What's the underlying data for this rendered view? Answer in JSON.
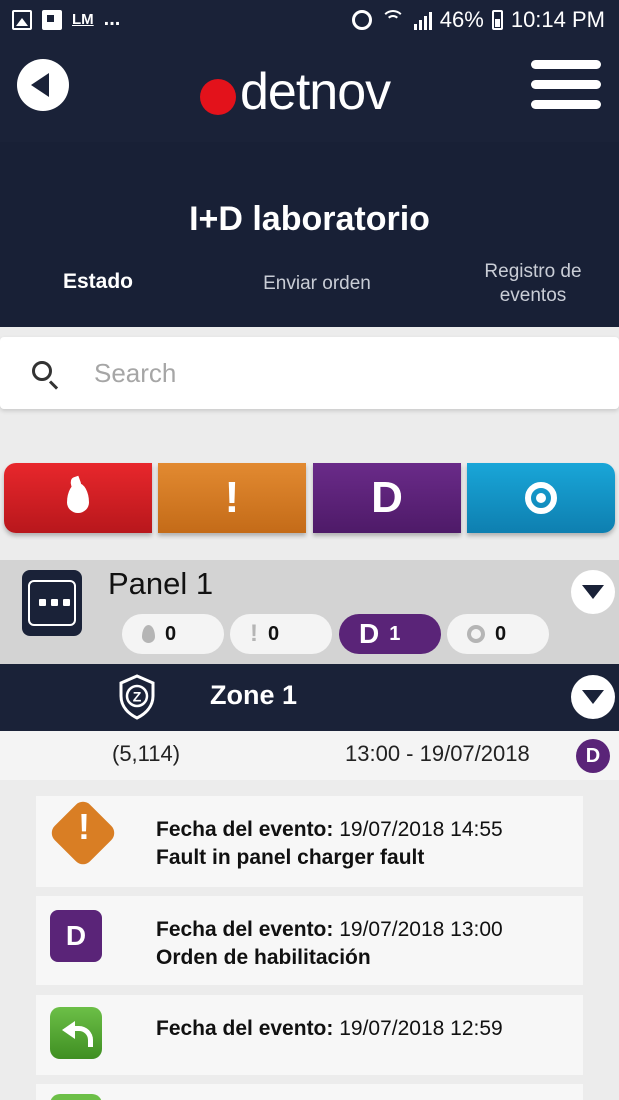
{
  "status_bar": {
    "lm_label": "LM",
    "more": "...",
    "battery": "46%",
    "time": "10:14 PM"
  },
  "header": {
    "logo_text": "detnov",
    "logo_dot_color": "#e3121b"
  },
  "page": {
    "title": "I+D laboratorio",
    "tabs": [
      {
        "label": "Estado",
        "active": true
      },
      {
        "label": "Enviar orden",
        "active": false
      },
      {
        "label": "Registro de eventos",
        "active": false
      }
    ]
  },
  "search": {
    "placeholder": "Search",
    "value": ""
  },
  "filters": [
    {
      "name": "fire",
      "icon": "flame-icon",
      "color": "#d81f24"
    },
    {
      "name": "fault",
      "icon": "exclamation-icon",
      "label": "!",
      "color": "#d67a22"
    },
    {
      "name": "disabled",
      "icon": "d-letter-icon",
      "label": "D",
      "color": "#5d2179"
    },
    {
      "name": "test",
      "icon": "sounder-icon",
      "color": "#1596c9"
    }
  ],
  "panel": {
    "title": "Panel 1",
    "counts": {
      "fire": "0",
      "fault": "0",
      "fault_symbol": "!",
      "disabled": "1",
      "disabled_symbol": "D",
      "test": "0"
    }
  },
  "zone": {
    "title": "Zone 1",
    "coords": "(5,114)",
    "time": "13:00 - 19/07/2018",
    "status_letter": "D"
  },
  "events": [
    {
      "icon": "fault-diamond-icon",
      "icon_symbol": "!",
      "label": "Fecha del evento:",
      "date": "19/07/2018 14:55",
      "description": "Fault in panel charger fault"
    },
    {
      "icon": "disabled-d-icon",
      "icon_symbol": "D",
      "label": "Fecha del evento:",
      "date": "19/07/2018 13:00",
      "description": "Orden de habilitación"
    },
    {
      "icon": "reset-arrow-icon",
      "label": "Fecha del evento:",
      "date": "19/07/2018 12:59",
      "description": ""
    }
  ],
  "colors": {
    "navy": "#1a2238",
    "purple": "#5a2478",
    "orange": "#d97e24",
    "green": "#4fa32e"
  }
}
